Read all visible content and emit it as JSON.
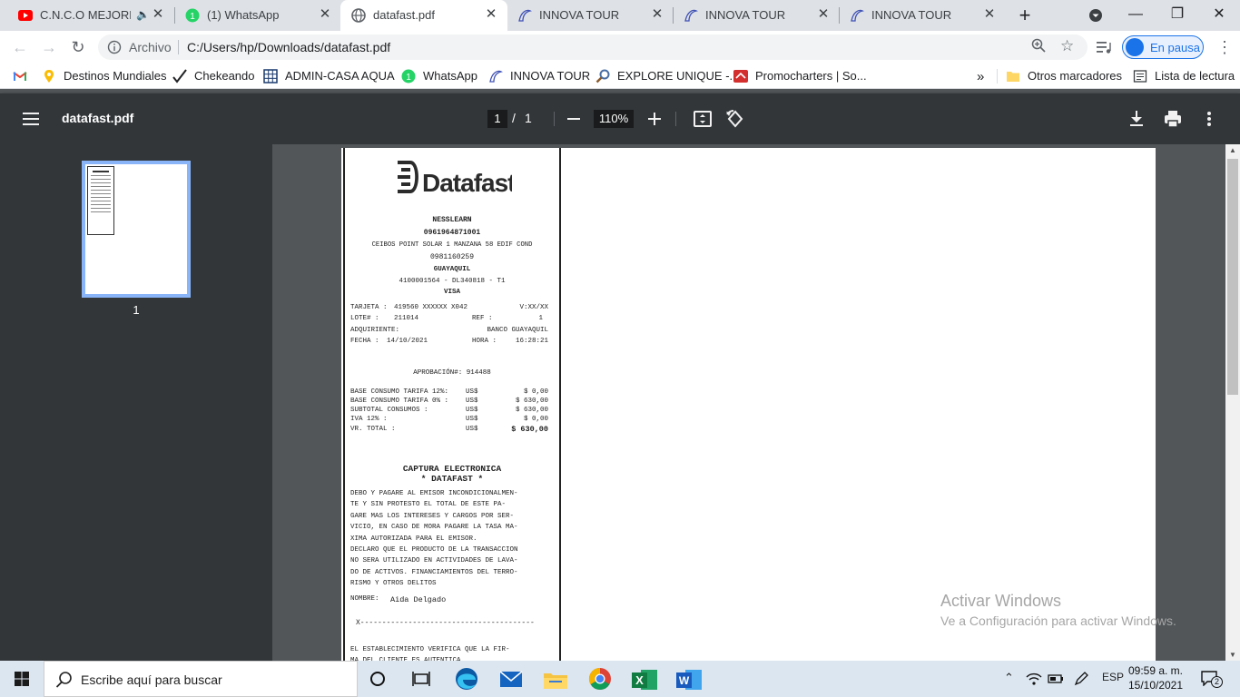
{
  "tabs": [
    {
      "title": "C.N.C.O MEJORES",
      "icon": "youtube-icon",
      "audio": true
    },
    {
      "title": "(1) WhatsApp",
      "icon": "whatsapp-icon"
    },
    {
      "title": "datafast.pdf",
      "icon": "globe-icon",
      "active": true
    },
    {
      "title": "INNOVA TOUR",
      "icon": "innova-icon"
    },
    {
      "title": "INNOVA TOUR",
      "icon": "innova-icon"
    },
    {
      "title": "INNOVA TOUR",
      "icon": "innova-icon"
    }
  ],
  "tab_close_glyph": "✕",
  "new_tab_glyph": "+",
  "window": {
    "minimize": "—",
    "maximize": "❐",
    "close": "✕"
  },
  "toolbar": {
    "site_label": "Archivo",
    "url": "C:/Users/hp/Downloads/datafast.pdf",
    "profile_label": "En pausa"
  },
  "bookmarks": [
    {
      "label": "",
      "icon": "gmail-icon"
    },
    {
      "label": "Destinos Mundiales",
      "icon": "location-pin-icon"
    },
    {
      "label": "Chekeando",
      "icon": "checkmark-icon"
    },
    {
      "label": "ADMIN-CASA AQUA",
      "icon": "grid-icon"
    },
    {
      "label": "WhatsApp",
      "icon": "whatsapp-icon"
    },
    {
      "label": "INNOVA TOUR",
      "icon": "innova-icon"
    },
    {
      "label": "EXPLORE UNIQUE -...",
      "icon": "magnifier-icon"
    },
    {
      "label": "Promocharters | So...",
      "icon": "promo-icon"
    }
  ],
  "bookmarks_overflow": "»",
  "bookmarks_folder": "Otros marcadores",
  "reading_list": "Lista de lectura",
  "pdf": {
    "title": "datafast.pdf",
    "page_current": "1",
    "page_sep": "/",
    "page_total": "1",
    "zoom": "110%",
    "thumb_label": "1"
  },
  "receipt": {
    "brand": "Datafast",
    "merchant": "NESSLEARN",
    "ruc": "0961964871001",
    "address": "CEIBOS POINT SOLAR 1 MANZANA 58 EDIF COND",
    "phone": "0981160259",
    "city": "GUAYAQUIL",
    "terminal": "4100001564 - DL340818 - T1",
    "card_brand": "VISA",
    "tarjeta_label": "TARJETA :",
    "tarjeta_value": "419560 XXXXXX X042",
    "vence": "V:XX/XX",
    "lote_label": "LOTE#   :",
    "lote_value": "211014",
    "ref_label": "REF  :",
    "ref_value": "1",
    "adq_label": "ADQUIRIENTE:",
    "adq_value": "BANCO GUAYAQUIL",
    "fecha_label": "FECHA   :",
    "fecha_value": "14/10/2021",
    "hora_label": "HORA :",
    "hora_value": "16:28:21",
    "aprobacion": "APROBACIÓN#: 914488",
    "amounts": [
      {
        "label": "BASE CONSUMO TARIFA 12%:",
        "cur": "US$",
        "value": "$ 0,00"
      },
      {
        "label": "BASE CONSUMO TARIFA 0% :",
        "cur": "US$",
        "value": "$ 630,00"
      },
      {
        "label": "SUBTOTAL CONSUMOS      :",
        "cur": "US$",
        "value": "$ 630,00"
      },
      {
        "label": "IVA 12%                :",
        "cur": "US$",
        "value": "$ 0,00"
      },
      {
        "label": "VR. TOTAL              :",
        "cur": "US$",
        "value": "$ 630,00"
      }
    ],
    "capture_title": "CAPTURA ELECTRONICA",
    "capture_sub": "* DATAFAST *",
    "legal": "DEBO Y PAGARE AL EMISOR INCONDICIONALMEN-\nTE Y SIN PROTESTO EL TOTAL DE ESTE PA-\nGARE MAS LOS INTERESES Y CARGOS POR SER-\nVICIO, EN CASO DE MORA PAGARE LA TASA MA-\nXIMA AUTORIZADA PARA EL EMISOR.\nDECLARO QUE EL PRODUCTO DE LA TRANSACCION\nNO SERA UTILIZADO EN ACTIVIDADES DE LAVA-\nDO DE ACTIVOS. FINANCIAMIENTOS DEL TERRO-\nRISMO Y OTROS DELITOS",
    "nombre_label": "NOMBRE:",
    "nombre_value": "Aida Delgado",
    "signature_line": "X----------------------------------------",
    "footer": "EL ESTABLECIMIENTO VERIFICA QUE LA FIR-\nMA DEL CLIENTE ES AUTENTICA"
  },
  "watermark": {
    "line1": "Activar Windows",
    "line2": "Ve a Configuración para activar Windows."
  },
  "taskbar": {
    "search_placeholder": "Escribe aquí para buscar",
    "lang": "ESP",
    "time": "09:59 a. m.",
    "date": "15/10/2021",
    "notifications": "2"
  },
  "colors": {
    "chrome_frame": "#dee1e6",
    "pdf_toolbar": "#323639",
    "pdf_background": "#525659",
    "accent": "#1a73e8",
    "taskbar": "#dce6f0"
  }
}
